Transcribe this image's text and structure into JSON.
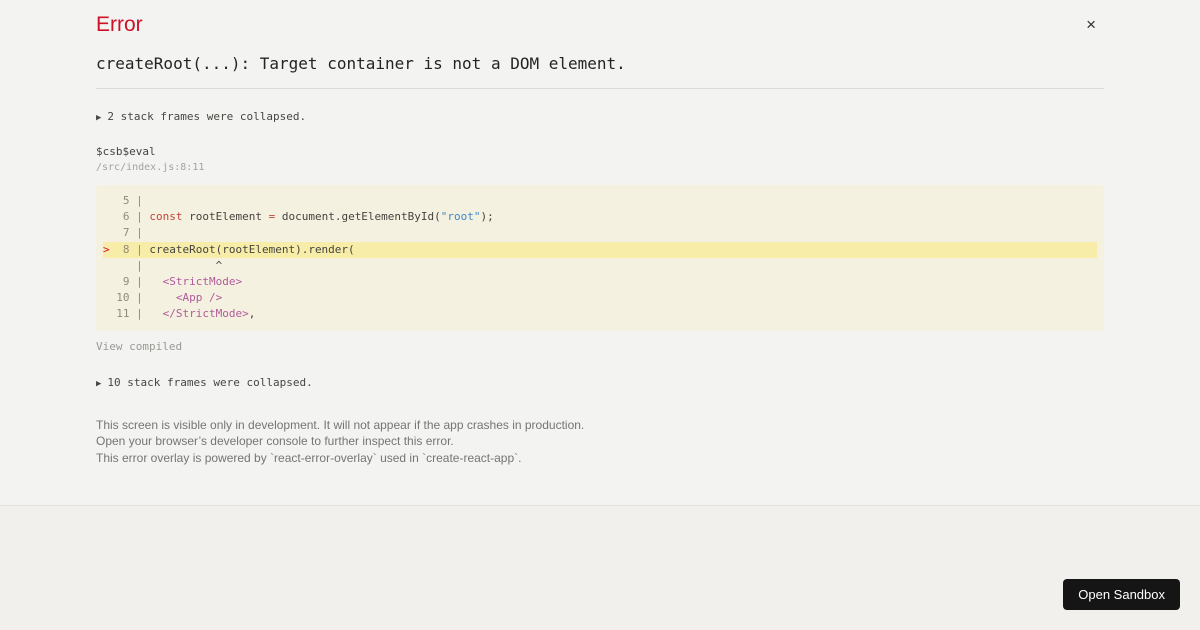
{
  "colors": {
    "error_red": "#ce1126",
    "code_background": "#f5f1e0",
    "code_highlight": "#f7eda9",
    "button_background": "#151515"
  },
  "header": {
    "title": "Error",
    "close_icon": "×"
  },
  "error": {
    "message": "createRoot(...): Target container is not a DOM element."
  },
  "stack": {
    "top_collapsed": {
      "icon": "▶",
      "label": "2 stack frames were collapsed."
    },
    "frame": {
      "function": "$csb$eval",
      "location": "/src/index.js:8:11"
    },
    "view_compiled_label": "View compiled",
    "bottom_collapsed": {
      "icon": "▶",
      "label": "10 stack frames were collapsed."
    }
  },
  "code_frame": {
    "lines": [
      {
        "marker": " ",
        "num": " 5",
        "highlight": false,
        "tokens": []
      },
      {
        "marker": " ",
        "num": " 6",
        "highlight": false,
        "tokens": [
          {
            "c": "kw",
            "s": "const"
          },
          {
            "c": "pl",
            "s": " rootElement "
          },
          {
            "c": "kw",
            "s": "="
          },
          {
            "c": "pl",
            "s": " document.getElementById("
          },
          {
            "c": "str",
            "s": "\"root\""
          },
          {
            "c": "pl",
            "s": ");"
          }
        ]
      },
      {
        "marker": " ",
        "num": " 7",
        "highlight": false,
        "tokens": []
      },
      {
        "marker": ">",
        "num": " 8",
        "highlight": true,
        "tokens": [
          {
            "c": "pl",
            "s": "createRoot(rootElement).render("
          }
        ]
      },
      {
        "marker": " ",
        "num": "  ",
        "highlight": false,
        "tokens": [
          {
            "c": "pl",
            "s": "          ^"
          }
        ]
      },
      {
        "marker": " ",
        "num": " 9",
        "highlight": false,
        "tokens": [
          {
            "c": "pl",
            "s": "  "
          },
          {
            "c": "jsx",
            "s": "<StrictMode>"
          }
        ]
      },
      {
        "marker": " ",
        "num": "10",
        "highlight": false,
        "tokens": [
          {
            "c": "pl",
            "s": "    "
          },
          {
            "c": "jsx",
            "s": "<App />"
          }
        ]
      },
      {
        "marker": " ",
        "num": "11",
        "highlight": false,
        "tokens": [
          {
            "c": "pl",
            "s": "  "
          },
          {
            "c": "jsx",
            "s": "</StrictMode>"
          },
          {
            "c": "pl",
            "s": ","
          }
        ]
      }
    ]
  },
  "footer": {
    "notes": [
      "This screen is visible only in development. It will not appear if the app crashes in production.",
      "Open your browser’s developer console to further inspect this error.",
      "This error overlay is powered by `react-error-overlay` used in `create-react-app`."
    ]
  },
  "sandbox": {
    "open_button_label": "Open Sandbox"
  }
}
